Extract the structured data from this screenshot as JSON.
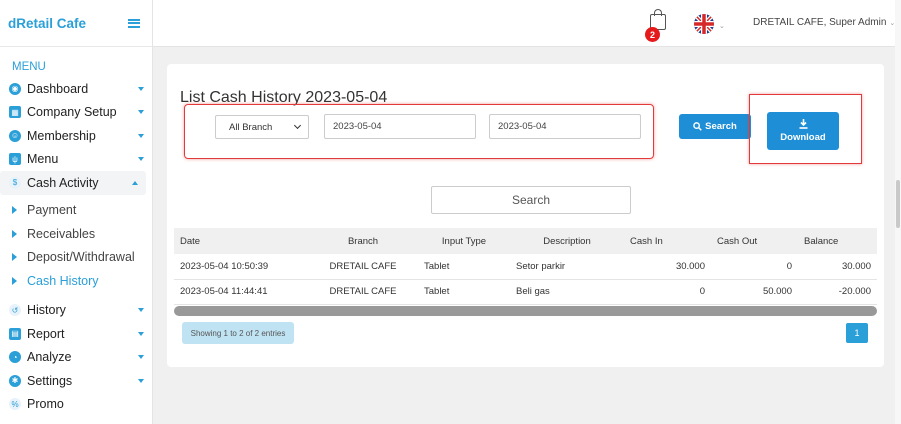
{
  "brand": "dRetail Cafe",
  "menu_title": "MENU",
  "sidebar": {
    "items": [
      {
        "label": "Dashboard",
        "icon": "dashboard-icon",
        "glyph": "◉"
      },
      {
        "label": "Company Setup",
        "icon": "building-icon",
        "glyph": "▦"
      },
      {
        "label": "Membership",
        "icon": "users-icon",
        "glyph": "☺"
      },
      {
        "label": "Menu",
        "icon": "utensils-icon",
        "glyph": "ψ"
      },
      {
        "label": "Cash Activity",
        "icon": "dollar-icon",
        "glyph": "$"
      }
    ],
    "subitems": [
      "Payment",
      "Receivables",
      "Deposit/Withdrawal",
      "Cash History"
    ],
    "items_bottom": [
      {
        "label": "History",
        "icon": "history-icon",
        "glyph": "↺"
      },
      {
        "label": "Report",
        "icon": "file-icon",
        "glyph": "▤"
      },
      {
        "label": "Analyze",
        "icon": "chart-pie-icon",
        "glyph": "◔"
      },
      {
        "label": "Settings",
        "icon": "gear-icon",
        "glyph": "✱"
      },
      {
        "label": "Promo",
        "icon": "percent-icon",
        "glyph": "%"
      }
    ]
  },
  "topbar": {
    "cart_count": "2",
    "user": "DRETAIL CAFE, Super Admin"
  },
  "page_title": "List Cash History 2023-05-04",
  "filters": {
    "branch": "All Branch",
    "date_from": "2023-05-04",
    "date_to": "2023-05-04",
    "search_button": "Search",
    "download_button": "Download"
  },
  "table_search_placeholder": "Search",
  "table": {
    "headers": [
      "Date",
      "Branch",
      "Input Type",
      "Description",
      "Cash In",
      "Cash Out",
      "Balance"
    ],
    "rows": [
      [
        "2023-05-04 10:50:39",
        "DRETAIL CAFE",
        "Tablet",
        "Setor parkir",
        "30.000",
        "0",
        "30.000"
      ],
      [
        "2023-05-04 11:44:41",
        "DRETAIL CAFE",
        "Tablet",
        "Beli gas",
        "0",
        "50.000",
        "-20.000"
      ]
    ]
  },
  "table_info": "Showing 1 to 2 of 2 entries",
  "pagination": {
    "current": "1"
  },
  "colors": {
    "accent": "#2a9fd8",
    "button": "#1e8fd6",
    "highlight": "#e23a3a",
    "badge": "#e51b1b"
  }
}
